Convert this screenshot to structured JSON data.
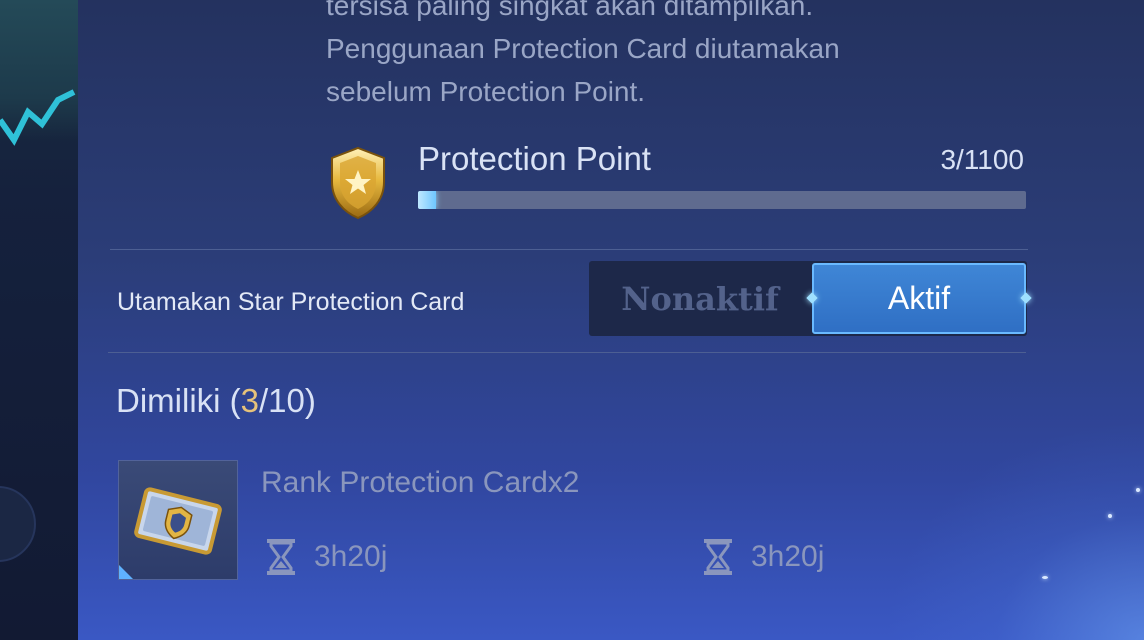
{
  "description": {
    "line1": "tersisa paling singkat akan ditampilkan.",
    "line2": "Penggunaan Protection Card diutamakan",
    "line3": "sebelum Protection Point."
  },
  "protection_point": {
    "label": "Protection Point",
    "value": "3/1100",
    "progress_fraction": 0.0027
  },
  "toggle": {
    "label": "Utamakan Star Protection Card",
    "off_label": "Nonaktif",
    "on_label": "Aktif",
    "selected": "Aktif"
  },
  "owned": {
    "prefix": "Dimiliki (",
    "count": "3",
    "suffix": "/10)"
  },
  "card": {
    "name": "Rank Protection Cardx2",
    "timers": [
      "3h20j",
      "3h20j"
    ]
  },
  "colors": {
    "accent": "#3f86d6",
    "highlight": "#e6c27a",
    "progress": "#6fc6ff"
  },
  "icons": [
    "shield-icon",
    "hourglass-icon",
    "protection-card-icon"
  ]
}
